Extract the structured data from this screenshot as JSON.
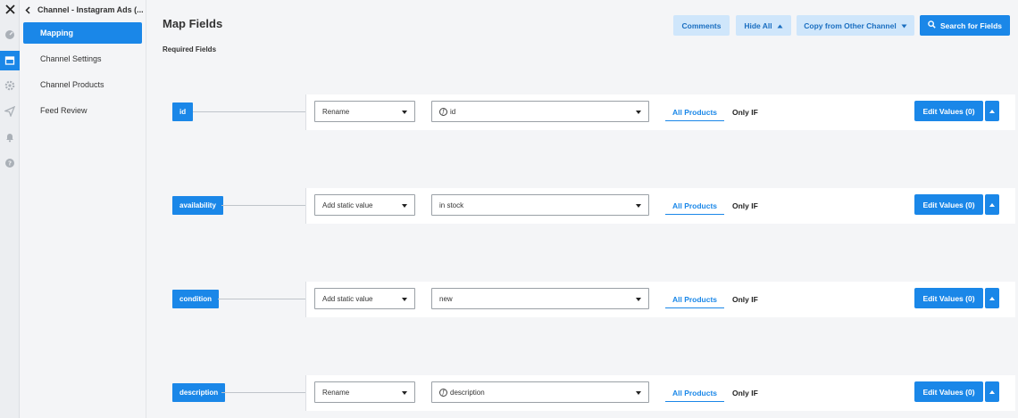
{
  "sidebar": {
    "channel_title": "Channel - Instagram Ads (...",
    "items": [
      {
        "label": "Mapping",
        "active": true
      },
      {
        "label": "Channel Settings",
        "active": false
      },
      {
        "label": "Channel Products",
        "active": false
      },
      {
        "label": "Feed Review",
        "active": false
      }
    ]
  },
  "rail_icons": [
    "close-icon",
    "dashboard-icon",
    "store-icon",
    "settings-icon",
    "send-icon",
    "bell-icon",
    "help-icon"
  ],
  "header": {
    "title": "Map Fields",
    "subtitle": "Required Fields",
    "buttons": {
      "comments": "Comments",
      "hide_all": "Hide All",
      "copy_from": "Copy from Other Channel",
      "search_fields": "Search for Fields"
    }
  },
  "rows": [
    {
      "field": "id",
      "method": "Rename",
      "value": "id",
      "value_is_field": true,
      "tab_all": "All Products",
      "tab_if": "Only IF",
      "edit_label": "Edit Values (0)"
    },
    {
      "field": "availability",
      "method": "Add static value",
      "value": "in stock",
      "value_is_field": false,
      "tab_all": "All Products",
      "tab_if": "Only IF",
      "edit_label": "Edit Values (0)"
    },
    {
      "field": "condition",
      "method": "Add static value",
      "value": "new",
      "value_is_field": false,
      "tab_all": "All Products",
      "tab_if": "Only IF",
      "edit_label": "Edit Values (0)"
    },
    {
      "field": "description",
      "method": "Rename",
      "value": "description",
      "value_is_field": true,
      "tab_all": "All Products",
      "tab_if": "Only IF",
      "edit_label": "Edit Values (0)"
    }
  ],
  "colors": {
    "accent": "#1a87e8",
    "accent_light": "#cfe6fb"
  }
}
